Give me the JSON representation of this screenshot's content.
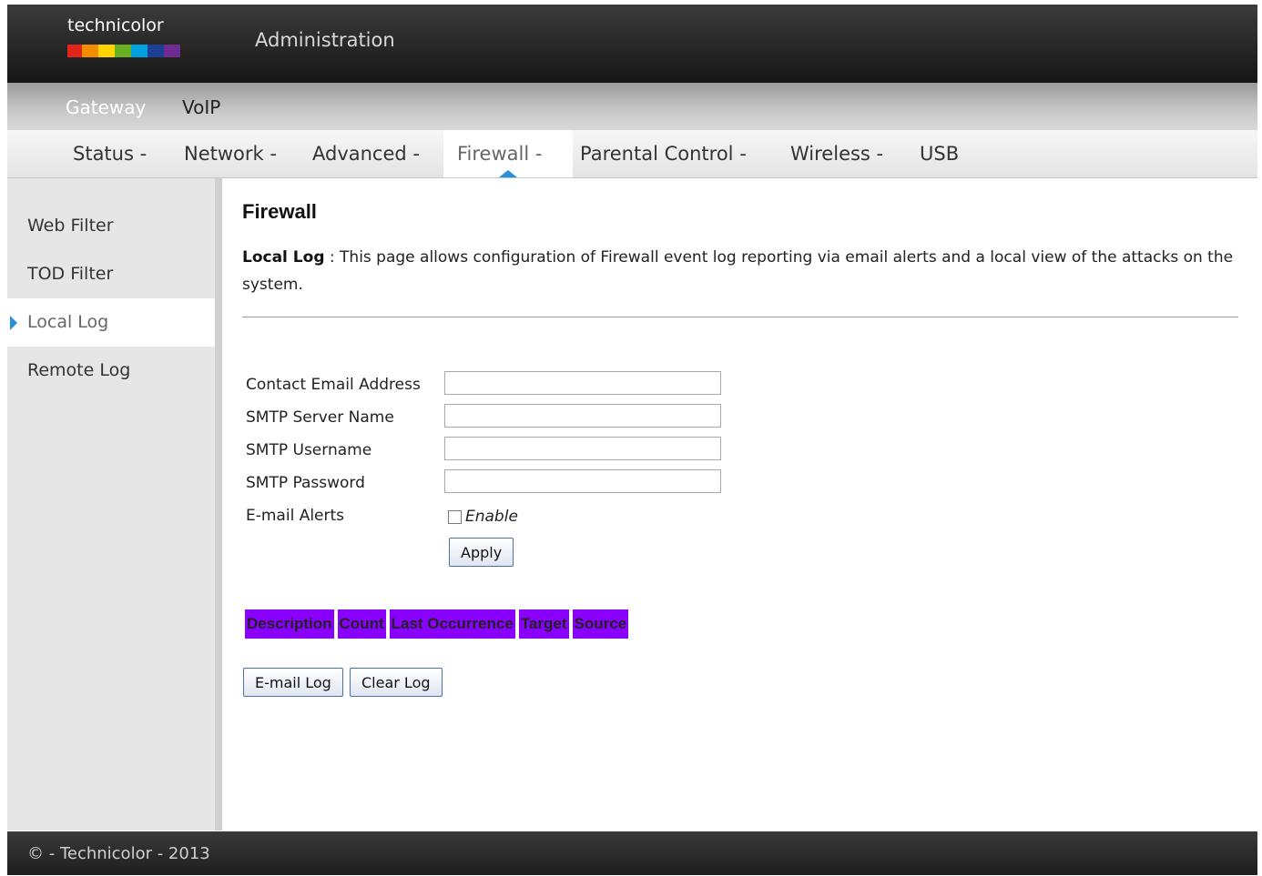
{
  "header": {
    "logo_text": "technicolor",
    "app_title": "Administration"
  },
  "brand_colors": [
    "#e1251b",
    "#f28c00",
    "#ffd400",
    "#6ab023",
    "#00a1de",
    "#1e3f96",
    "#6f2b90"
  ],
  "topnav": {
    "items": [
      {
        "label": "Gateway",
        "active": true
      },
      {
        "label": "VoIP",
        "active": false
      }
    ]
  },
  "subnav": {
    "items": [
      {
        "label": "Status -"
      },
      {
        "label": "Network -"
      },
      {
        "label": "Advanced -"
      },
      {
        "label": "Firewall -",
        "active": true
      },
      {
        "label": "Parental Control -"
      },
      {
        "label": "Wireless -"
      },
      {
        "label": "USB"
      }
    ]
  },
  "sidebar": {
    "items": [
      {
        "label": "Web Filter"
      },
      {
        "label": "TOD Filter"
      },
      {
        "label": "Local Log",
        "active": true
      },
      {
        "label": "Remote Log"
      }
    ]
  },
  "main": {
    "title": "Firewall",
    "desc_label": "Local Log",
    "desc_text": " :  This page allows configuration of Firewall event log reporting via email alerts and a local view of the attacks on the system.",
    "form": {
      "contact_email_label": "Contact Email Address",
      "contact_email_value": "",
      "smtp_server_label": "SMTP Server Name",
      "smtp_server_value": "",
      "smtp_username_label": "SMTP Username",
      "smtp_username_value": "",
      "smtp_password_label": "SMTP Password",
      "smtp_password_value": "",
      "email_alerts_label": "E-mail Alerts",
      "enable_label": "Enable",
      "enable_checked": false,
      "apply_label": "Apply"
    },
    "log_table": {
      "columns": [
        "Description",
        "Count",
        "Last Occurrence",
        "Target",
        "Source"
      ],
      "header_color": "#8a00ff"
    },
    "buttons": {
      "email_log": "E-mail Log",
      "clear_log": "Clear Log"
    }
  },
  "footer": {
    "text": "© - Technicolor - 2013"
  }
}
